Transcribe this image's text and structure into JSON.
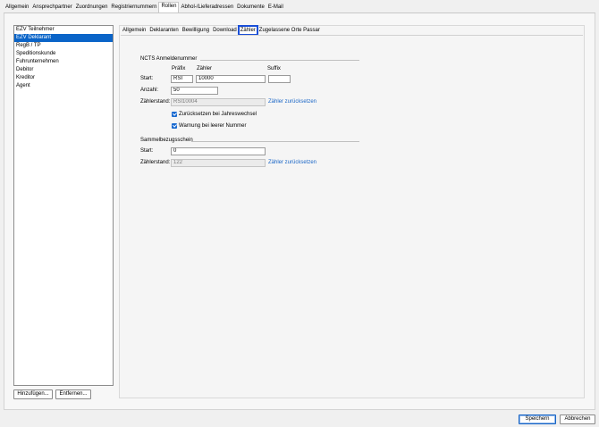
{
  "top_tabs": [
    {
      "label": "Allgemein",
      "active": false
    },
    {
      "label": "Ansprechpartner",
      "active": false
    },
    {
      "label": "Zuordnungen",
      "active": false
    },
    {
      "label": "Registriernummern",
      "active": false
    },
    {
      "label": "Rollen",
      "active": true
    },
    {
      "label": "Abhol-/Lieferadressen",
      "active": false
    },
    {
      "label": "Dokumente",
      "active": false
    },
    {
      "label": "E-Mail",
      "active": false
    }
  ],
  "roles": {
    "items": [
      "EZV Teilnehmer",
      "EZV Deklarant",
      "RegB / TP",
      "Speditionskunde",
      "Fuhrunternehmen",
      "Debitor",
      "Kreditor",
      "Agent"
    ],
    "selected_index": 1,
    "add_label": "Hinzufügen...",
    "remove_label": "Entfernen..."
  },
  "sub_tabs": [
    {
      "label": "Allgemein",
      "active": false
    },
    {
      "label": "Deklaranten",
      "active": false
    },
    {
      "label": "Bewilligung",
      "active": false
    },
    {
      "label": "Download",
      "active": false
    },
    {
      "label": "Zähler",
      "active": true
    },
    {
      "label": "Zugelassene Orte Passar",
      "active": false
    }
  ],
  "ncts": {
    "title": "NCTS Anmeldenummer",
    "col_prefix": "Präfix",
    "col_counter": "Zähler",
    "col_suffix": "Suffix",
    "start_label": "Start:",
    "prefix_value": "RSI",
    "counter_value": "10000",
    "suffix_value": "",
    "count_label": "Anzahl:",
    "count_value": "50",
    "state_label": "Zählerstand:",
    "state_value": "RSI10004",
    "reset_link": "Zähler zurücksetzen",
    "checkbox_yearly": {
      "label": "Zurücksetzen bei Jahreswechsel",
      "checked": true
    },
    "checkbox_warn": {
      "label": "Warnung bei leerer Nummer",
      "checked": true
    }
  },
  "sammel": {
    "title": "Sammelbezugsschein",
    "start_label": "Start:",
    "start_value": "0",
    "state_label": "Zählerstand:",
    "state_value": "122",
    "reset_link": "Zähler zurücksetzen"
  },
  "footer": {
    "save_label": "Speichern",
    "cancel_label": "Abbrechen"
  },
  "colors": {
    "accent": "#0a64c8",
    "link": "#1a66c6"
  }
}
